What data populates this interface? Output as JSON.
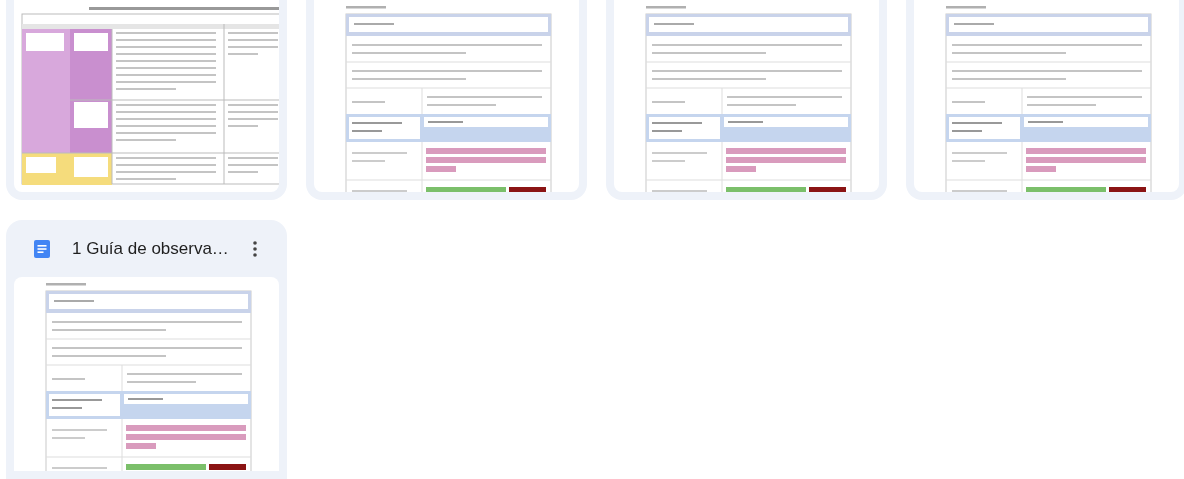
{
  "files": [
    {
      "kind": "table"
    },
    {
      "kind": "guide"
    },
    {
      "kind": "guide"
    },
    {
      "kind": "guide"
    },
    {
      "kind": "guide",
      "title": "1 Guía de observa…"
    }
  ]
}
